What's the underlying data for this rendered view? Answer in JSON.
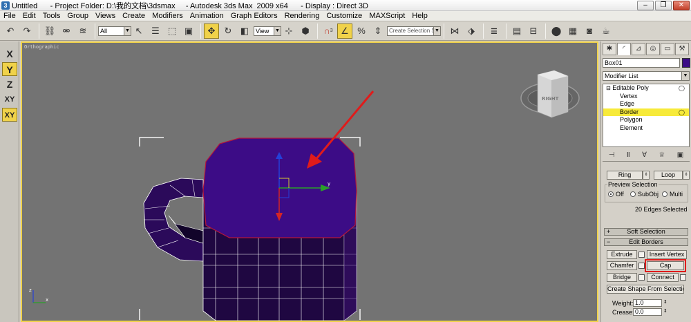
{
  "window": {
    "title": "Untitled      - Project Folder: D:\\我的文档\\3dsmax     - Autodesk 3ds Max  2009 x64      - Display : Direct 3D"
  },
  "menu": [
    "File",
    "Edit",
    "Tools",
    "Group",
    "Views",
    "Create",
    "Modifiers",
    "Animation",
    "Graph Editors",
    "Rendering",
    "Customize",
    "MAXScript",
    "Help"
  ],
  "toolbar": {
    "filter_value": "All",
    "view_value": "View",
    "selection_set_placeholder": "Create Selection Set",
    "snap_label": "3"
  },
  "axis_constraints": [
    "X",
    "Y",
    "Z",
    "XY",
    "XY"
  ],
  "viewport": {
    "label": "Orthographic",
    "viewcube_label": "RIGHT",
    "gizmo_y_label": "y",
    "axis_tripod": {
      "z": "z",
      "x": "x"
    }
  },
  "object": {
    "name": "Box01",
    "color": "#3c0c86"
  },
  "modifier_list": {
    "label": "Modifier List"
  },
  "modifier_stack": [
    {
      "label": "Editable Poly",
      "level": 0,
      "selected": false,
      "bulb": true
    },
    {
      "label": "Vertex",
      "level": 1,
      "selected": false
    },
    {
      "label": "Edge",
      "level": 1,
      "selected": false
    },
    {
      "label": "Border",
      "level": 1,
      "selected": true,
      "bulb": true
    },
    {
      "label": "Polygon",
      "level": 1,
      "selected": false
    },
    {
      "label": "Element",
      "level": 1,
      "selected": false
    }
  ],
  "selection": {
    "ring_label": "Ring",
    "loop_label": "Loop",
    "preview_group": "Preview Selection",
    "preview_options": [
      "Off",
      "SubObj",
      "Multi"
    ],
    "preview_selected": "Off",
    "status": "20 Edges Selected"
  },
  "rollouts": {
    "soft_selection": "Soft Selection",
    "edit_borders": "Edit Borders"
  },
  "edit_borders": {
    "extrude": "Extrude",
    "insert_vertex": "Insert Vertex",
    "chamfer": "Chamfer",
    "cap": "Cap",
    "bridge": "Bridge",
    "connect": "Connect",
    "create_shape": "Create Shape From Selection",
    "weight_label": "Weight:",
    "weight_value": "1.0",
    "crease_label": "Crease:",
    "crease_value": "0.0"
  },
  "colors": {
    "object_face": "#3c0c86",
    "selection_highlight": "#f7ea3a",
    "active_tool": "#f0d24a",
    "annotation_red": "#e01b1b",
    "viewport_bg": "#737373"
  }
}
